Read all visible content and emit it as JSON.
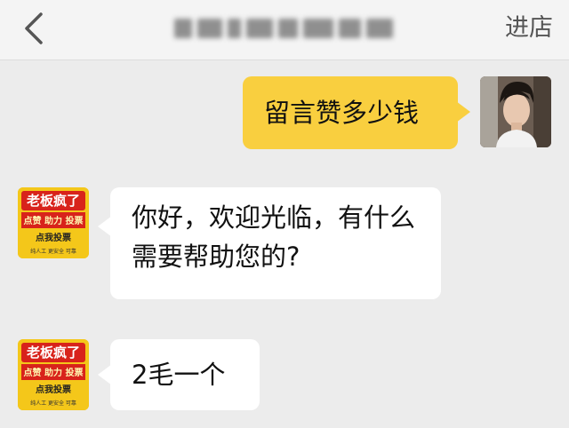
{
  "header": {
    "title": "",
    "enter_shop_label": "进店"
  },
  "messages": [
    {
      "sender": "user",
      "text": "留言赞多少钱"
    },
    {
      "sender": "shop",
      "text": "你好，欢迎光临，有什么需要帮助您的?"
    },
    {
      "sender": "shop",
      "text": "2毛一个"
    }
  ],
  "shop_avatar": {
    "line1": "老板疯了",
    "line2": "点赞 助力 投票",
    "line3": "点我投票",
    "line4": "纯人工 更安全 可靠"
  },
  "colors": {
    "outgoing_bubble": "#f9cf3f",
    "incoming_bubble": "#ffffff",
    "background": "#ececec",
    "avatar_yellow": "#f4c71a",
    "avatar_red": "#d8231b"
  },
  "icons": {
    "back": "chevron-left-icon"
  }
}
